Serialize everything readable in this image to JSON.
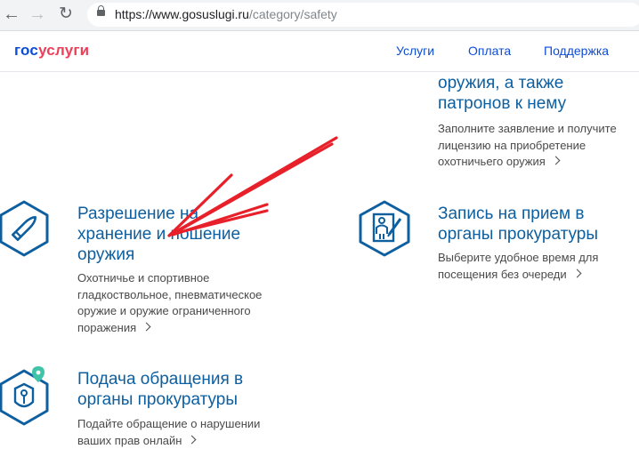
{
  "browser": {
    "back_icon": "←",
    "forward_icon": "→",
    "reload_icon": "↻",
    "url_host": "https://www.gosuslugi.ru",
    "url_path": "/category/safety"
  },
  "header": {
    "logo_part1": "гос",
    "logo_part2": "услуги",
    "nav": [
      "Услуги",
      "Оплата",
      "Поддержка"
    ]
  },
  "services": {
    "hunting_purchase": {
      "title_line1": "оружия, а также",
      "title_line2": "патронов к нему",
      "desc_lines": [
        "Заполните заявление и получите",
        "лицензию на приобретение",
        "охотничьего оружия"
      ]
    },
    "weapon_permit": {
      "title_line1": "Разрешение на",
      "title_line2": "хранение и ношение",
      "title_line3": "оружия",
      "desc_lines": [
        "Охотничье и спортивное",
        "гладкоствольное, пневматическое",
        "оружие и оружие ограниченного",
        "поражения"
      ]
    },
    "prosecutor_appointment": {
      "title_line1": "Запись на прием в",
      "title_line2": "органы прокуратуры",
      "desc_lines": [
        "Выберите удобное время для",
        "посещения без очереди"
      ]
    },
    "prosecutor_appeal": {
      "title_line1": "Подача обращения в",
      "title_line2": "органы прокуратуры",
      "desc_lines": [
        "Подайте обращение о нарушении",
        "ваших прав онлайн"
      ]
    }
  },
  "colors": {
    "title": "#0d5fa0",
    "icon": "#0d5fa0",
    "logo_blue": "#0d4cd3",
    "logo_red": "#ee3f58",
    "annotation_arrow": "#e8202a",
    "pin_badge": "#3fc4a8"
  }
}
